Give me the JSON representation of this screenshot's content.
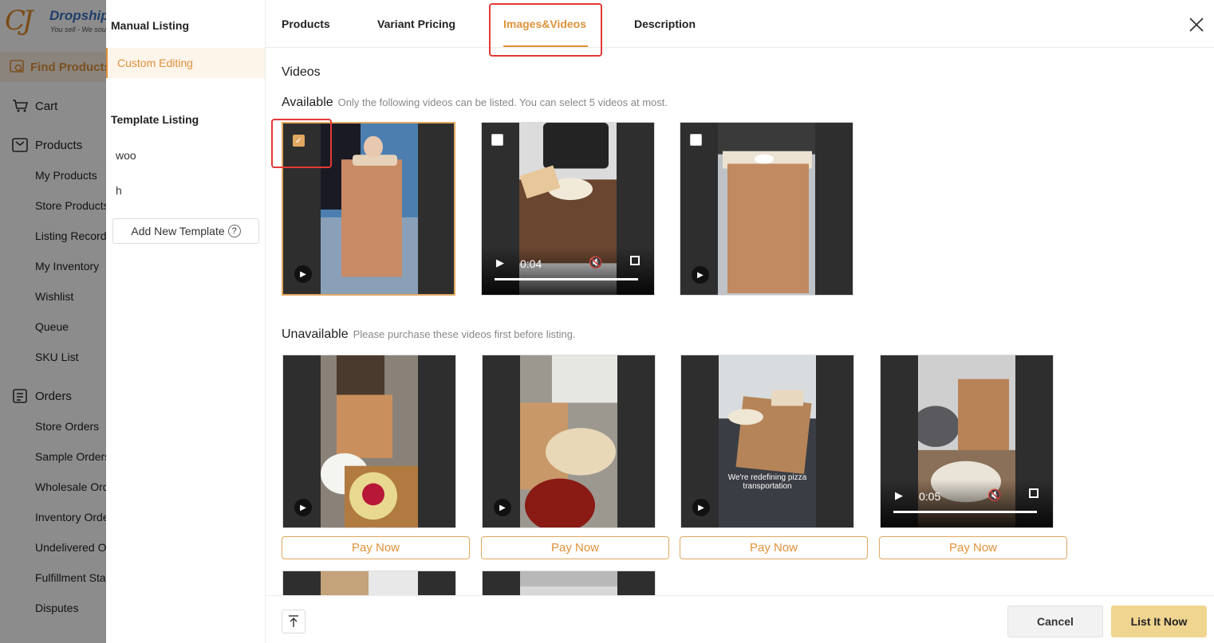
{
  "brand": {
    "name": "Dropship",
    "tagline": "You sell - We sourc",
    "mark": "CJ"
  },
  "sidebar": {
    "items": [
      {
        "label": "Find Products",
        "icon": "search-products-icon"
      },
      {
        "label": "Cart",
        "icon": "cart-icon"
      },
      {
        "label": "Products",
        "icon": "box-icon"
      },
      {
        "label": "My Products"
      },
      {
        "label": "Store Products"
      },
      {
        "label": "Listing Records"
      },
      {
        "label": "My Inventory"
      },
      {
        "label": "Wishlist"
      },
      {
        "label": "Queue"
      },
      {
        "label": "SKU List"
      },
      {
        "label": "Orders",
        "icon": "orders-icon"
      },
      {
        "label": "Store Orders"
      },
      {
        "label": "Sample Orders"
      },
      {
        "label": "Wholesale Orders"
      },
      {
        "label": "Inventory Orders"
      },
      {
        "label": "Undelivered Orders"
      },
      {
        "label": "Fulfillment Status"
      },
      {
        "label": "Disputes"
      }
    ]
  },
  "listing_panel": {
    "manual_heading": "Manual Listing",
    "custom_editing": "Custom Editing",
    "template_heading": "Template Listing",
    "templates": [
      "woo",
      "h"
    ],
    "add_template": "Add New Template",
    "help_glyph": "?"
  },
  "tabs": [
    "Products",
    "Variant Pricing",
    "Images&Videos",
    "Description"
  ],
  "active_tab": "Images&Videos",
  "videos": {
    "title": "Videos",
    "available_label": "Available",
    "available_hint": "Only the following videos can be listed. You can select 5 videos at most.",
    "unavailable_label": "Unavailable",
    "unavailable_hint": "Please purchase these videos first before listing.",
    "available": [
      {
        "checked": true,
        "time": ""
      },
      {
        "checked": false,
        "time": "0:04"
      },
      {
        "checked": false,
        "time": ""
      }
    ],
    "unavailable": [
      {
        "time": "",
        "caption": ""
      },
      {
        "time": "",
        "caption": ""
      },
      {
        "time": "",
        "caption": "We're redefining pizza transportation"
      },
      {
        "time": "0:05",
        "caption": ""
      }
    ],
    "pay_label": "Pay Now"
  },
  "footer": {
    "cancel": "Cancel",
    "list_now": "List It Now"
  },
  "colors": {
    "accent": "#e0923a",
    "highlight": "#e53935",
    "primary_button": "#f0d590"
  }
}
